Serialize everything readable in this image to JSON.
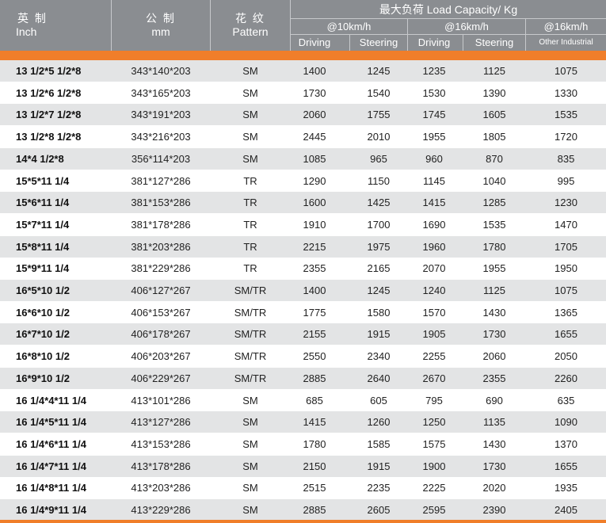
{
  "header": {
    "inch_cn": "英 制",
    "inch_en": "Inch",
    "mm_cn": "公  制",
    "mm_en": "mm",
    "pattern_cn": "花  纹",
    "pattern_en": "Pattern",
    "load_title": "最大负荷 Load Capacity/  Kg",
    "speed1": "@10km/h",
    "speed2": "@16km/h",
    "speed3": "@16km/h",
    "driving1": "Driving",
    "steering1": "Steering",
    "driving2": "Driving",
    "steering2": "Steering",
    "other": "Other Industrial"
  },
  "rows": [
    {
      "inch": "13 1/2*5 1/2*8",
      "mm": "343*140*203",
      "pattern": "SM",
      "d10": "1400",
      "s10": "1245",
      "d16": "1235",
      "s16": "1125",
      "other": "1075"
    },
    {
      "inch": "13 1/2*6 1/2*8",
      "mm": "343*165*203",
      "pattern": "SM",
      "d10": "1730",
      "s10": "1540",
      "d16": "1530",
      "s16": "1390",
      "other": "1330"
    },
    {
      "inch": "13 1/2*7 1/2*8",
      "mm": "343*191*203",
      "pattern": "SM",
      "d10": "2060",
      "s10": "1755",
      "d16": "1745",
      "s16": "1605",
      "other": "1535"
    },
    {
      "inch": "13 1/2*8 1/2*8",
      "mm": "343*216*203",
      "pattern": "SM",
      "d10": "2445",
      "s10": "2010",
      "d16": "1955",
      "s16": "1805",
      "other": "1720"
    },
    {
      "inch": "14*4 1/2*8",
      "mm": "356*114*203",
      "pattern": "SM",
      "d10": "1085",
      "s10": "965",
      "d16": "960",
      "s16": "870",
      "other": "835"
    },
    {
      "inch": "15*5*11 1/4",
      "mm": "381*127*286",
      "pattern": "TR",
      "d10": "1290",
      "s10": "1150",
      "d16": "1145",
      "s16": "1040",
      "other": "995"
    },
    {
      "inch": "15*6*11 1/4",
      "mm": "381*153*286",
      "pattern": "TR",
      "d10": "1600",
      "s10": "1425",
      "d16": "1415",
      "s16": "1285",
      "other": "1230"
    },
    {
      "inch": "15*7*11 1/4",
      "mm": "381*178*286",
      "pattern": "TR",
      "d10": "1910",
      "s10": "1700",
      "d16": "1690",
      "s16": "1535",
      "other": "1470"
    },
    {
      "inch": "15*8*11 1/4",
      "mm": "381*203*286",
      "pattern": "TR",
      "d10": "2215",
      "s10": "1975",
      "d16": "1960",
      "s16": "1780",
      "other": "1705"
    },
    {
      "inch": "15*9*11 1/4",
      "mm": "381*229*286",
      "pattern": "TR",
      "d10": "2355",
      "s10": "2165",
      "d16": "2070",
      "s16": "1955",
      "other": "1950"
    },
    {
      "inch": "16*5*10 1/2",
      "mm": "406*127*267",
      "pattern": "SM/TR",
      "d10": "1400",
      "s10": "1245",
      "d16": "1240",
      "s16": "1125",
      "other": "1075"
    },
    {
      "inch": "16*6*10 1/2",
      "mm": "406*153*267",
      "pattern": "SM/TR",
      "d10": "1775",
      "s10": "1580",
      "d16": "1570",
      "s16": "1430",
      "other": "1365"
    },
    {
      "inch": "16*7*10 1/2",
      "mm": "406*178*267",
      "pattern": "SM/TR",
      "d10": "2155",
      "s10": "1915",
      "d16": "1905",
      "s16": "1730",
      "other": "1655"
    },
    {
      "inch": "16*8*10 1/2",
      "mm": "406*203*267",
      "pattern": "SM/TR",
      "d10": "2550",
      "s10": "2340",
      "d16": "2255",
      "s16": "2060",
      "other": "2050"
    },
    {
      "inch": "16*9*10 1/2",
      "mm": "406*229*267",
      "pattern": "SM/TR",
      "d10": "2885",
      "s10": "2640",
      "d16": "2670",
      "s16": "2355",
      "other": "2260"
    },
    {
      "inch": "16 1/4*4*11 1/4",
      "mm": "413*101*286",
      "pattern": "SM",
      "d10": "685",
      "s10": "605",
      "d16": "795",
      "s16": "690",
      "other": "635"
    },
    {
      "inch": "16 1/4*5*11 1/4",
      "mm": "413*127*286",
      "pattern": "SM",
      "d10": "1415",
      "s10": "1260",
      "d16": "1250",
      "s16": "1135",
      "other": "1090"
    },
    {
      "inch": "16 1/4*6*11 1/4",
      "mm": "413*153*286",
      "pattern": "SM",
      "d10": "1780",
      "s10": "1585",
      "d16": "1575",
      "s16": "1430",
      "other": "1370"
    },
    {
      "inch": "16 1/4*7*11 1/4",
      "mm": "413*178*286",
      "pattern": "SM",
      "d10": "2150",
      "s10": "1915",
      "d16": "1900",
      "s16": "1730",
      "other": "1655"
    },
    {
      "inch": "16 1/4*8*11 1/4",
      "mm": "413*203*286",
      "pattern": "SM",
      "d10": "2515",
      "s10": "2235",
      "d16": "2225",
      "s16": "2020",
      "other": "1935"
    },
    {
      "inch": "16 1/4*9*11 1/4",
      "mm": "413*229*286",
      "pattern": "SM",
      "d10": "2885",
      "s10": "2605",
      "d16": "2595",
      "s16": "2390",
      "other": "2405"
    }
  ],
  "colors": {
    "header_bg": "#8a8d91",
    "accent_orange": "#f07e2a",
    "row_shade": "#e3e4e5",
    "row_plain": "#ffffff"
  }
}
